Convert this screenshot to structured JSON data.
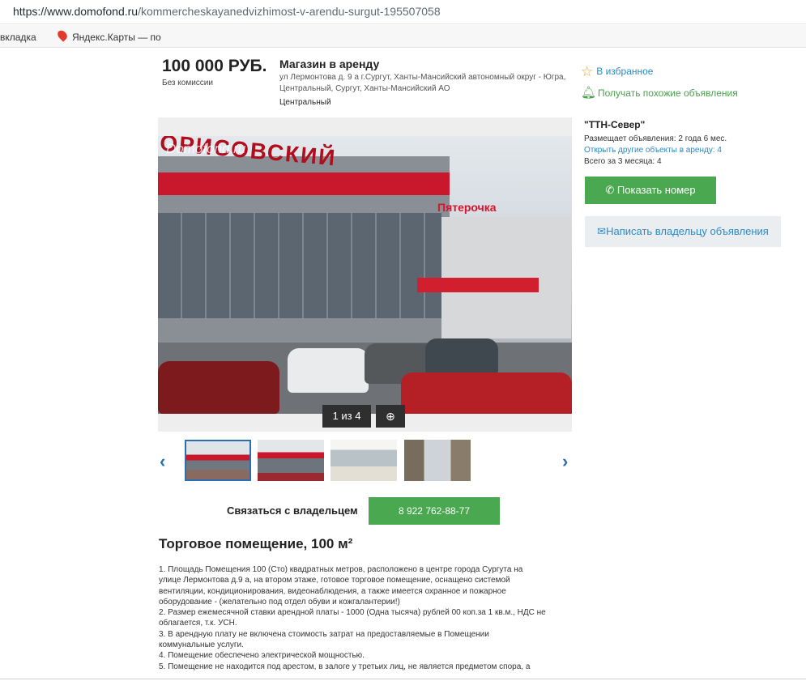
{
  "browser": {
    "url_scheme_host": "https://www.domofond.ru",
    "url_path": "/kommercheskayanedvizhimost-v-arendu-surgut-195507058",
    "bookmarks": [
      {
        "label": "вкладка"
      },
      {
        "label": "Яндекс.Карты — по"
      }
    ]
  },
  "listing": {
    "price": "100 000 РУБ.",
    "commission": "Без комиссии",
    "title": "Магазин в аренду",
    "address": "ул Лермонтова д. 9 а г.Сургут, Ханты-Мансийский автономный округ - Югра, Центральный, Сургут, Ханты-Мансийский АО",
    "district": "Центральный",
    "favorite_label": "В избранное",
    "similar_label": "Получать похожие объявления"
  },
  "seller": {
    "name": "\"ТТН-Север\"",
    "posting_duration": "Размещает объявления: 2 года 6 мес.",
    "other_listings": "Открыть другие объекты в аренду: 4",
    "total_3_months": "Всего за 3 месяца: 4",
    "show_phone": "Показать номер",
    "write_owner": "Написать владельцу объявления"
  },
  "gallery": {
    "watermark": "Domofond.ru",
    "store_sign": "ОРИСОВСКИЙ",
    "brand_sign": "Пятерочка",
    "counter": "1 из 4",
    "thumbnail_count": 4
  },
  "contact": {
    "label": "Связаться с владельцем",
    "phone": "8 922 762-88-77"
  },
  "description": {
    "heading": "Торговое помещение, 100 м²",
    "lines": [
      "1. Площадь Помещения 100 (Сто) квадратных метров, расположено в центре города Сургута на",
      "улице Лермонтова д.9 а, на втором этаже, готовое торговое помещение, оснащено системой",
      "вентиляции, кондиционирования, видеонаблюдения, а также имеется охранное и пожарное",
      "оборудование - (желательно под отдел обуви и кожгалантерии!)",
      "2. Размер ежемесячной ставки арендной платы - 1000 (Одна тысяча) рублей 00 коп.за 1 кв.м., НДС не",
      "облагается, т.к. УСН.",
      "3. В арендную плату не включена стоимость затрат на предоставляемые в Помещении",
      "коммунальные услуги.",
      "4. Помещение обеспечено электрической мощностью.",
      "5. Помещение не находится под арестом, в залоге у третьих лиц, не является предметом спора, а"
    ]
  }
}
